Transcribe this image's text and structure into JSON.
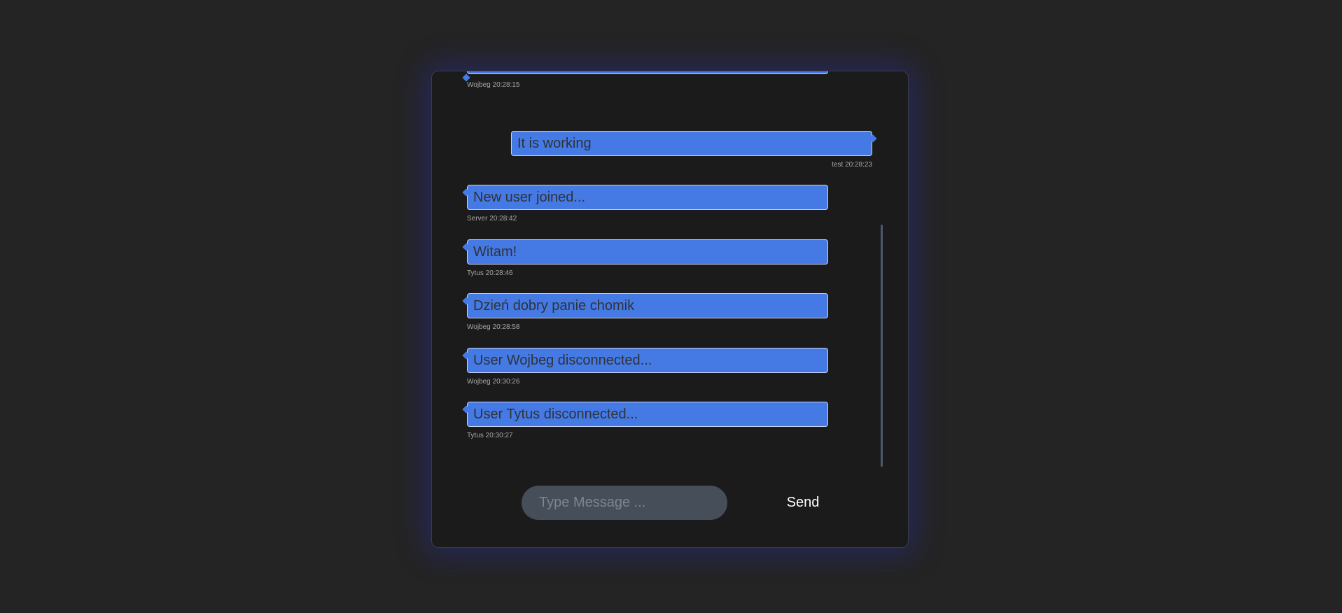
{
  "chat": {
    "messages": [
      {
        "text": "",
        "sender": "Wojbeg",
        "time": "20:28:15",
        "meta": "Wojbeg 20:28:15",
        "side": "left"
      },
      {
        "text": "It is working",
        "sender": "test",
        "time": "20:28:23",
        "meta": "test 20:28:23",
        "side": "right"
      },
      {
        "text": "New user joined...",
        "sender": "Server",
        "time": "20:28:42",
        "meta": "Server 20:28:42",
        "side": "left"
      },
      {
        "text": "Witam!",
        "sender": "Tytus",
        "time": "20:28:46",
        "meta": "Tytus 20:28:46",
        "side": "left"
      },
      {
        "text": "Dzień dobry panie chomik",
        "sender": "Wojbeg",
        "time": "20:28:58",
        "meta": "Wojbeg 20:28:58",
        "side": "left"
      },
      {
        "text": "User Wojbeg disconnected...",
        "sender": "Wojbeg",
        "time": "20:30:26",
        "meta": "Wojbeg 20:30:26",
        "side": "left"
      },
      {
        "text": "User Tytus disconnected...",
        "sender": "Tytus",
        "time": "20:30:27",
        "meta": "Tytus 20:30:27",
        "side": "left"
      }
    ]
  },
  "composer": {
    "placeholder": "Type Message ...",
    "value": "",
    "send_label": "Send"
  },
  "colors": {
    "page_background": "#242424",
    "card_background": "#1b1b1b",
    "bubble": "#4579e4",
    "bubble_text": "#2f3338",
    "input_background": "#464e59",
    "glow": "#282c96"
  }
}
